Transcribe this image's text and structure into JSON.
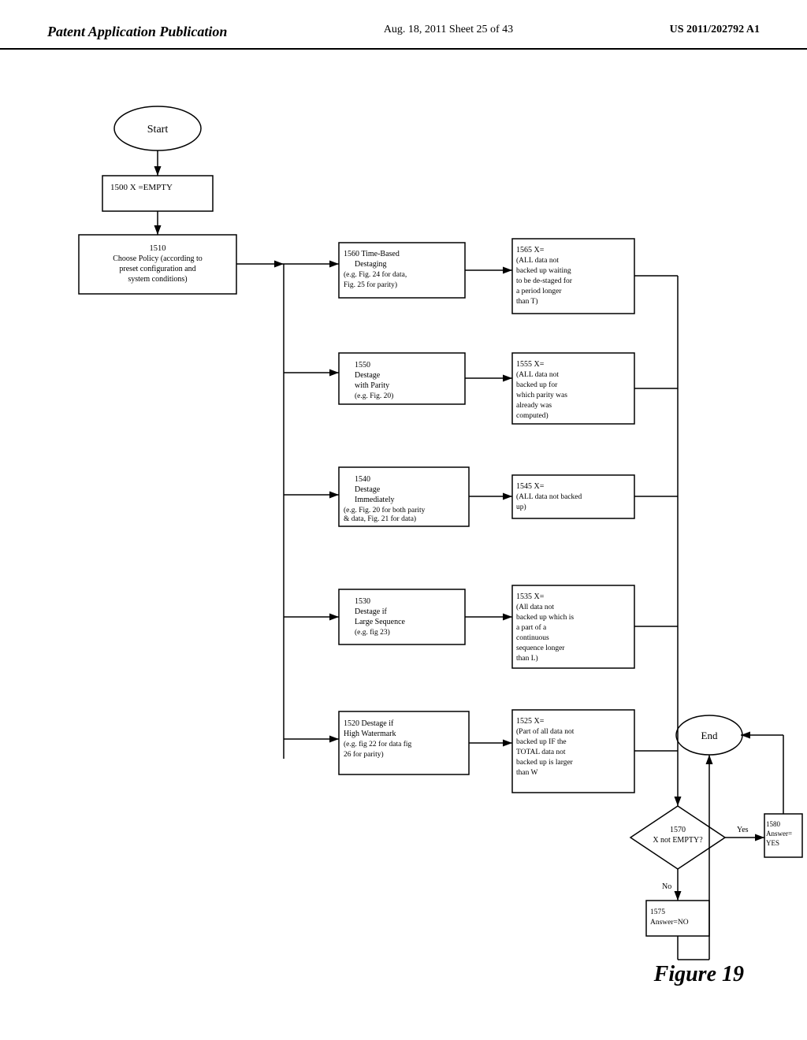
{
  "header": {
    "left_label": "Patent Application Publication",
    "center_label": "Aug. 18, 2011  Sheet 25 of 43",
    "right_label": "US 2011/202792 A1"
  },
  "figure": {
    "label": "Figure 19"
  },
  "nodes": {
    "start": {
      "id": "start",
      "label": "Start",
      "type": "oval"
    },
    "n1500": {
      "id": "n1500",
      "label": "1500 X =EMPTY",
      "type": "rect"
    },
    "n1510": {
      "id": "n1510",
      "label": "1510\nChoose Policy (according to\npreset configuration and\nsystem conditions)",
      "type": "rect"
    },
    "n1520": {
      "id": "n1520",
      "label": "1520 Destage if\nHigh Watermark\n(e.g. fig 22 for data fig\n26 for parity)",
      "type": "rect"
    },
    "n1525": {
      "id": "n1525",
      "label": "1525 X=\n(Part of all data not\nbacked up IF the\nTOTAL data not\nbacked up is larger\nthan W",
      "type": "rect"
    },
    "n1530": {
      "id": "n1530",
      "label": "1530\nDestage if\nLarge Sequence\n(e.g. fig 23)",
      "type": "rect"
    },
    "n1535": {
      "id": "n1535",
      "label": "1535 X=\n(All data not\nbacked up which is\na part of a\ncontinuous\nsequence longer\nthan L)",
      "type": "rect"
    },
    "n1540": {
      "id": "n1540",
      "label": "1540\nDestage\nImmediately\n(e.g. Fig. 20 for both parity\n& data, Fig. 21 for data)",
      "type": "rect"
    },
    "n1545": {
      "id": "n1545",
      "label": "1545 X=\n(ALL data not backed\nup)",
      "type": "rect"
    },
    "n1550": {
      "id": "n1550",
      "label": "1550\nDestage\nwith Parity\n(e.g. Fig. 20)",
      "type": "rect"
    },
    "n1555": {
      "id": "n1555",
      "label": "1555 X=\n(ALL data not\nbacked up for\nwhich parity was\nalready was\ncomputed)",
      "type": "rect"
    },
    "n1560": {
      "id": "n1560",
      "label": "1560 Time-Based\nDestaging\n(e.g. Fig. 24 for data,\nFig. 25 for parity)",
      "type": "rect"
    },
    "n1565": {
      "id": "n1565",
      "label": "1565 X=\n(ALL data not\nbacked up waiting\nto be de-staged for\na period longer\nthan T)",
      "type": "rect"
    },
    "n1570": {
      "id": "n1570",
      "label": "1570\nX not EMPTY?",
      "type": "diamond"
    },
    "n1575": {
      "id": "n1575",
      "label": "1575\nAnswer=NO",
      "type": "rect"
    },
    "n1580": {
      "id": "n1580",
      "label": "1580\nAnswer=YES",
      "type": "rect"
    },
    "end": {
      "id": "end",
      "label": "End",
      "type": "oval"
    }
  }
}
